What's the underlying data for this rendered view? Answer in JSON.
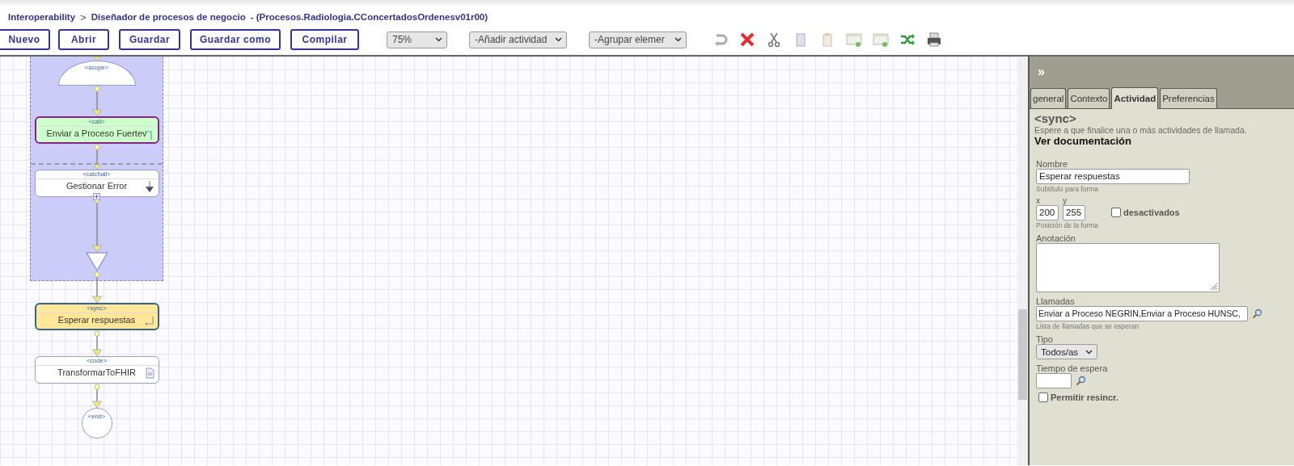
{
  "breadcrumb": {
    "root": "Interoperability",
    "separator": ">",
    "title": "Diseñador de procesos de negocio",
    "subtitle": "- (Procesos.Radiologia.CConcertadosOrdenesv01r00)"
  },
  "toolbar": {
    "buttons": [
      "Nuevo",
      "Abrir",
      "Guardar",
      "Guardar como",
      "Compilar"
    ],
    "selects": [
      {
        "kind": "zoom",
        "value": "75%"
      },
      {
        "kind": "menu",
        "value": "-Añadir actividad"
      },
      {
        "kind": "menu",
        "value": "-Agrupar elemer"
      }
    ]
  },
  "diagram": {
    "group": {
      "nodes": [
        {
          "kind": "scope",
          "tag": "<scope>",
          "selected": false
        },
        {
          "kind": "call",
          "tag": "<call>",
          "label": "Enviar a Proceso Fuertev",
          "selected": false
        },
        {
          "kind": "catchall",
          "tag": "<catchall>",
          "label": "Gestionar Error",
          "selected": false
        },
        {
          "kind": "join",
          "selected": false
        }
      ]
    },
    "nodes": [
      {
        "kind": "sync",
        "tag": "<sync>",
        "label": "Esperar respuestas",
        "selected": true
      },
      {
        "kind": "code",
        "tag": "<code>",
        "label": "TransformarToFHIR",
        "selected": false
      },
      {
        "kind": "end",
        "tag": "<end>",
        "selected": false
      }
    ]
  },
  "panel": {
    "collapse": "»",
    "tabs": [
      {
        "label": "general",
        "selected": false
      },
      {
        "label": "Contexto",
        "selected": false
      },
      {
        "label": "Actividad",
        "selected": true
      },
      {
        "label": "Preferencias",
        "selected": false
      }
    ],
    "heading": "<sync>",
    "description": "Espere a que finalice una o más actividades de llamada.",
    "doc_link": "Ver documentación",
    "name": {
      "label": "Nombre",
      "value": "Esperar respuestas",
      "hint": "Subtítulo para forma"
    },
    "position": {
      "x_label": "x",
      "x_value": "200",
      "y_label": "y",
      "y_value": "255",
      "hint": "Posición de la forma"
    },
    "disabled": {
      "label": "desactivados",
      "checked": false
    },
    "annotation": {
      "label": "Anotación"
    },
    "calls": {
      "label": "Llamadas",
      "value": "Enviar a Proceso NEGRIN,Enviar a Proceso HUNSC,",
      "hint": "Lista de llamadas que se esperan"
    },
    "type": {
      "label": "Tipo",
      "value": "Todos/as"
    },
    "timeout": {
      "label": "Tiempo de espera"
    },
    "allow_resync": {
      "label": "Permitir resincr.",
      "checked": false
    }
  }
}
